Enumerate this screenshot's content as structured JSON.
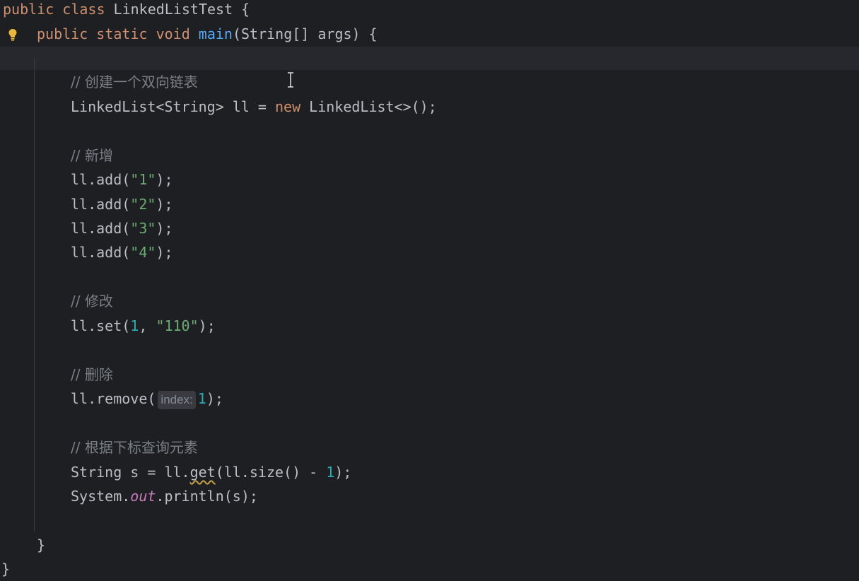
{
  "editor": {
    "lines": {
      "l1": {
        "kw": "public class ",
        "name": "LinkedListTest",
        "rest": " {"
      },
      "l2": {
        "kw": "public static void ",
        "fn": "main",
        "rest": "(String[] args) {"
      },
      "c1": "// 创建一个双向链表",
      "l4": {
        "a": "LinkedList<String> ll = ",
        "kw": "new",
        "b": " LinkedList<>();"
      },
      "c2": "// 新增",
      "adds": [
        {
          "a": "ll.add(",
          "s": "\"1\"",
          "b": ");"
        },
        {
          "a": "ll.add(",
          "s": "\"2\"",
          "b": ");"
        },
        {
          "a": "ll.add(",
          "s": "\"3\"",
          "b": ");"
        },
        {
          "a": "ll.add(",
          "s": "\"4\"",
          "b": ");"
        }
      ],
      "c3": "// 修改",
      "set": {
        "a": "ll.set(",
        "n": "1",
        "mid": ", ",
        "s": "\"110\"",
        "b": ");"
      },
      "c4": "// 删除",
      "remove": {
        "a": "ll.remove(",
        "hint": "index:",
        "n": "1",
        "b": ");"
      },
      "c5": "// 根据下标查询元素",
      "get": {
        "a": "String s = ll.",
        "warn": "get",
        "b": "(ll.size() - ",
        "n": "1",
        "c": ");"
      },
      "print": {
        "a": "System.",
        "field": "out",
        "b": ".println(s);"
      },
      "close_method": "}",
      "close_class": "}"
    },
    "icons": {
      "bulb": "lightbulb-icon",
      "cursor": "text-cursor-icon"
    },
    "colors": {
      "background": "#1e1f22",
      "keyword": "#cf8e6d",
      "function": "#56a8f5",
      "string": "#6aab73",
      "number": "#2aacb8",
      "comment": "#7a7e85"
    }
  }
}
